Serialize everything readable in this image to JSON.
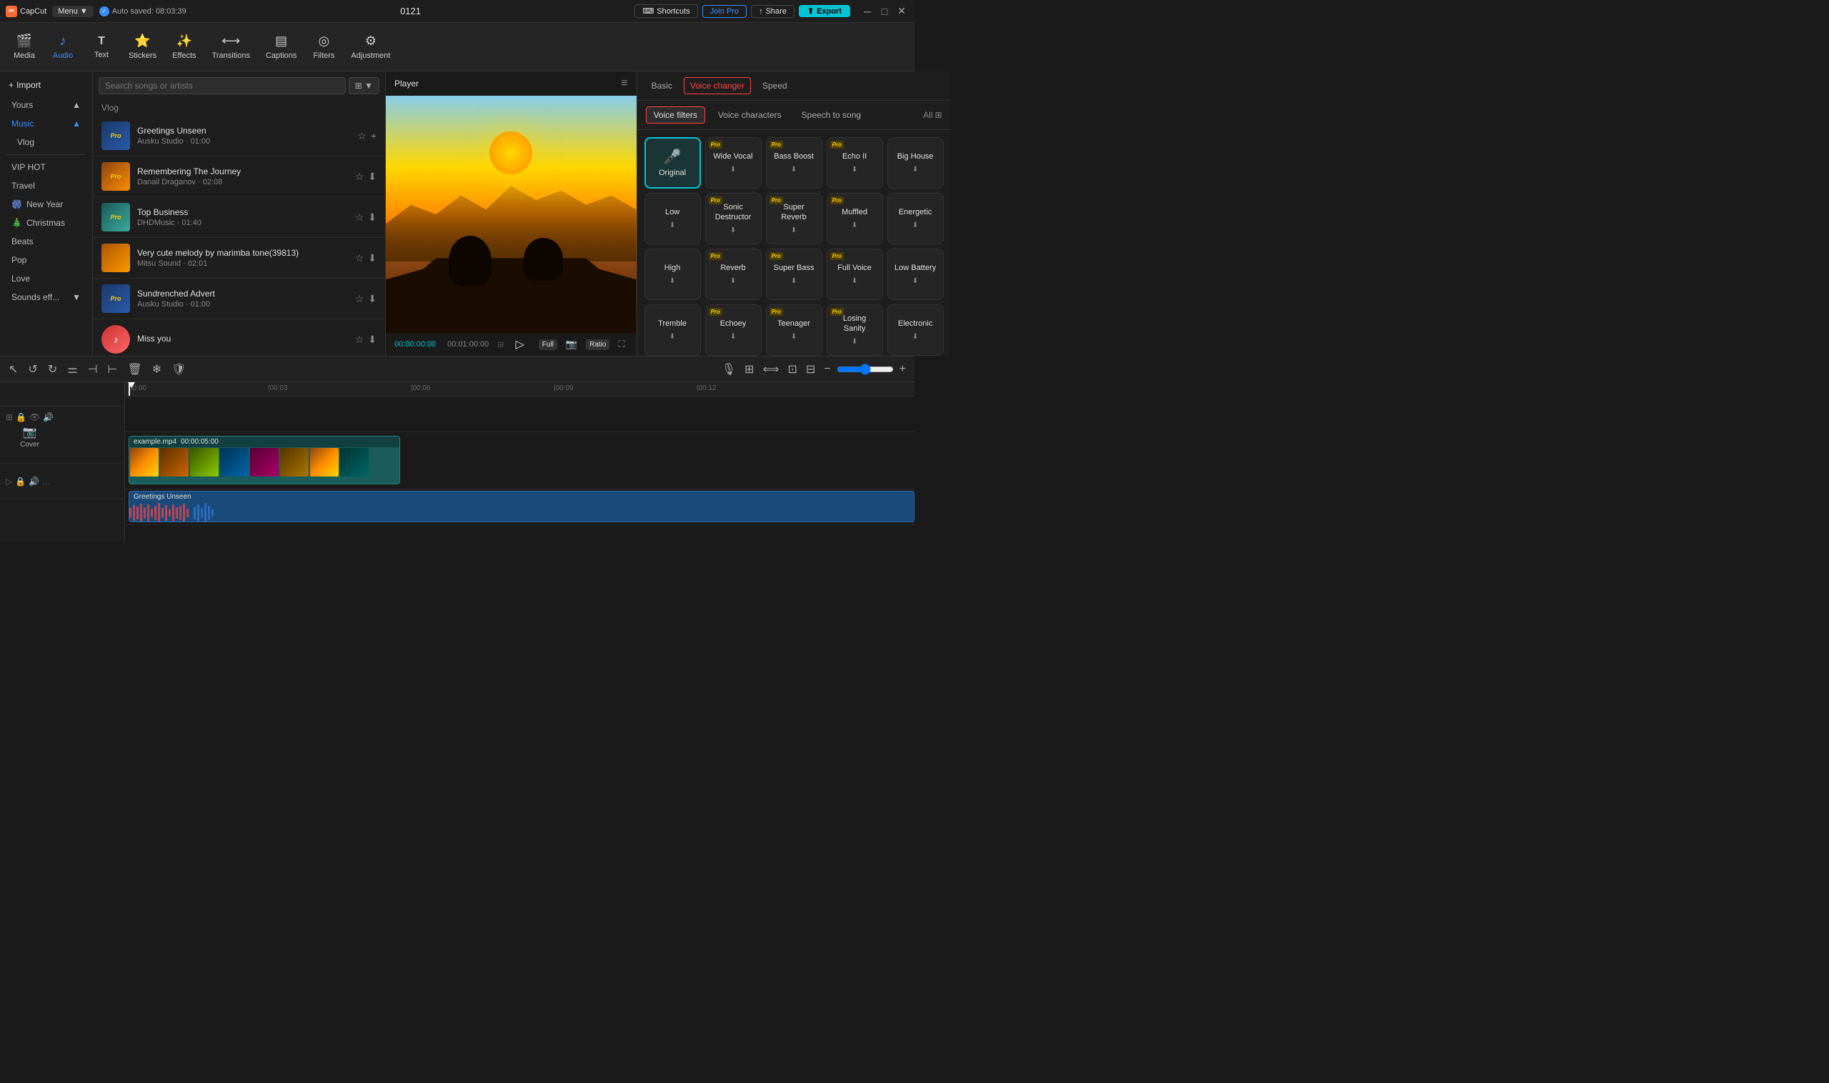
{
  "app": {
    "name": "CapCut",
    "menu_label": "Menu",
    "auto_saved": "Auto saved: 08:03:39",
    "title": "0121"
  },
  "topbar": {
    "shortcuts_label": "Shortcuts",
    "join_pro_label": "Join Pro",
    "share_label": "Share",
    "export_label": "Export"
  },
  "toolbar": {
    "items": [
      {
        "id": "media",
        "label": "Media",
        "icon": "🎬"
      },
      {
        "id": "audio",
        "label": "Audio",
        "icon": "♪",
        "active": true
      },
      {
        "id": "text",
        "label": "Text",
        "icon": "T"
      },
      {
        "id": "stickers",
        "label": "Stickers",
        "icon": "⭐"
      },
      {
        "id": "effects",
        "label": "Effects",
        "icon": "✨"
      },
      {
        "id": "transitions",
        "label": "Transitions",
        "icon": "⟷"
      },
      {
        "id": "captions",
        "label": "Captions",
        "icon": "▤"
      },
      {
        "id": "filters",
        "label": "Filters",
        "icon": "◎"
      },
      {
        "id": "adjustment",
        "label": "Adjustment",
        "icon": "⚙"
      }
    ]
  },
  "sidebar": {
    "import_label": "Import",
    "items": [
      {
        "id": "yours",
        "label": "Yours",
        "has_arrow": true
      },
      {
        "id": "music",
        "label": "Music",
        "has_arrow": true,
        "active": true
      },
      {
        "id": "vlog",
        "label": "Vlog",
        "active": false
      },
      {
        "id": "vip_hot",
        "label": "VIP HOT"
      },
      {
        "id": "travel",
        "label": "Travel"
      },
      {
        "id": "new_year",
        "label": "New Year",
        "icon": "🎆"
      },
      {
        "id": "christmas",
        "label": "Christmas",
        "icon": "🎄"
      },
      {
        "id": "beats",
        "label": "Beats"
      },
      {
        "id": "pop",
        "label": "Pop"
      },
      {
        "id": "love",
        "label": "Love"
      },
      {
        "id": "sounds_eff",
        "label": "Sounds eff...",
        "has_arrow": true
      }
    ]
  },
  "audio_panel": {
    "search_placeholder": "Search songs or artists",
    "section_label": "Vlog",
    "tracks": [
      {
        "id": 1,
        "title": "Greetings Unseen",
        "meta": "Ausku Studio · 01:00",
        "thumb_type": "blue",
        "pro": true
      },
      {
        "id": 2,
        "title": "Remembering The Journey",
        "meta": "Danail Draganov · 02:08",
        "thumb_type": "orange",
        "pro": true
      },
      {
        "id": 3,
        "title": "Top Business",
        "meta": "DHDMusic · 01:40",
        "thumb_type": "teal",
        "pro": true
      },
      {
        "id": 4,
        "title": "Very cute melody by marimba tone(39813)",
        "meta": "Mitsu Sound · 02:01",
        "thumb_type": "orange2",
        "pro": false
      },
      {
        "id": 5,
        "title": "Sundrenched Advert",
        "meta": "Ausku Studio · 01:00",
        "thumb_type": "blue",
        "pro": true
      },
      {
        "id": 6,
        "title": "Miss  you",
        "meta": "",
        "thumb_type": "miss",
        "pro": false
      }
    ]
  },
  "player": {
    "title": "Player",
    "time_current": "00:00:00:00",
    "time_total": "00:01:00:00",
    "quality": "Full",
    "ratio_label": "Ratio"
  },
  "right_panel": {
    "tabs": [
      {
        "id": "basic",
        "label": "Basic"
      },
      {
        "id": "voice_changer",
        "label": "Voice changer",
        "active": true
      },
      {
        "id": "speed",
        "label": "Speed"
      }
    ],
    "sub_tabs": [
      {
        "id": "voice_filters",
        "label": "Voice filters",
        "active": true
      },
      {
        "id": "voice_characters",
        "label": "Voice characters"
      },
      {
        "id": "speech_to_song",
        "label": "Speech to song"
      }
    ],
    "all_label": "All",
    "voice_filters": [
      {
        "id": "original",
        "label": "Original",
        "pro": false,
        "active": true,
        "download": false
      },
      {
        "id": "wide_vocal",
        "label": "Wide Vocal",
        "pro": true,
        "download": true
      },
      {
        "id": "bass_boost",
        "label": "Bass Boost",
        "pro": true,
        "download": true
      },
      {
        "id": "echo_ii",
        "label": "Echo II",
        "pro": true,
        "download": true
      },
      {
        "id": "big_house",
        "label": "Big House",
        "pro": false,
        "download": true
      },
      {
        "id": "low",
        "label": "Low",
        "pro": false,
        "download": true
      },
      {
        "id": "sonic_destructor",
        "label": "Sonic Destructor",
        "pro": true,
        "download": true
      },
      {
        "id": "super_reverb",
        "label": "Super Reverb",
        "pro": true,
        "download": true
      },
      {
        "id": "muffled",
        "label": "Muffled",
        "pro": true,
        "download": true
      },
      {
        "id": "energetic",
        "label": "Energetic",
        "pro": false,
        "download": true
      },
      {
        "id": "high",
        "label": "High",
        "pro": false,
        "download": true
      },
      {
        "id": "reverb",
        "label": "Reverb",
        "pro": true,
        "download": true
      },
      {
        "id": "super_bass",
        "label": "Super Bass",
        "pro": true,
        "download": true
      },
      {
        "id": "full_voice",
        "label": "Full Voice",
        "pro": true,
        "download": true
      },
      {
        "id": "low_battery",
        "label": "Low Battery",
        "pro": false,
        "download": true
      },
      {
        "id": "tremble",
        "label": "Tremble",
        "pro": false,
        "download": true
      },
      {
        "id": "echoey",
        "label": "Echoey",
        "pro": true,
        "download": true
      },
      {
        "id": "teenager",
        "label": "Teenager",
        "pro": true,
        "download": true
      },
      {
        "id": "losing_sanity",
        "label": "Losing Sanity",
        "pro": true,
        "download": true
      },
      {
        "id": "electronic",
        "label": "Electronic",
        "pro": false,
        "download": true
      }
    ]
  },
  "timeline": {
    "ruler_marks": [
      "00:00",
      "|00:03",
      "|00:06",
      "|00:09",
      "|00:12"
    ],
    "video_clip": {
      "name": "example.mp4",
      "duration": "00:00:05:00"
    },
    "audio_clip": {
      "name": "Greetings Unseen"
    },
    "cover_label": "Cover"
  },
  "colors": {
    "accent": "#3a8fff",
    "active_tab": "#ff4444",
    "teal": "#00c4d4",
    "pro_gold": "#ffcc00",
    "original_border": "#00c4d4"
  }
}
